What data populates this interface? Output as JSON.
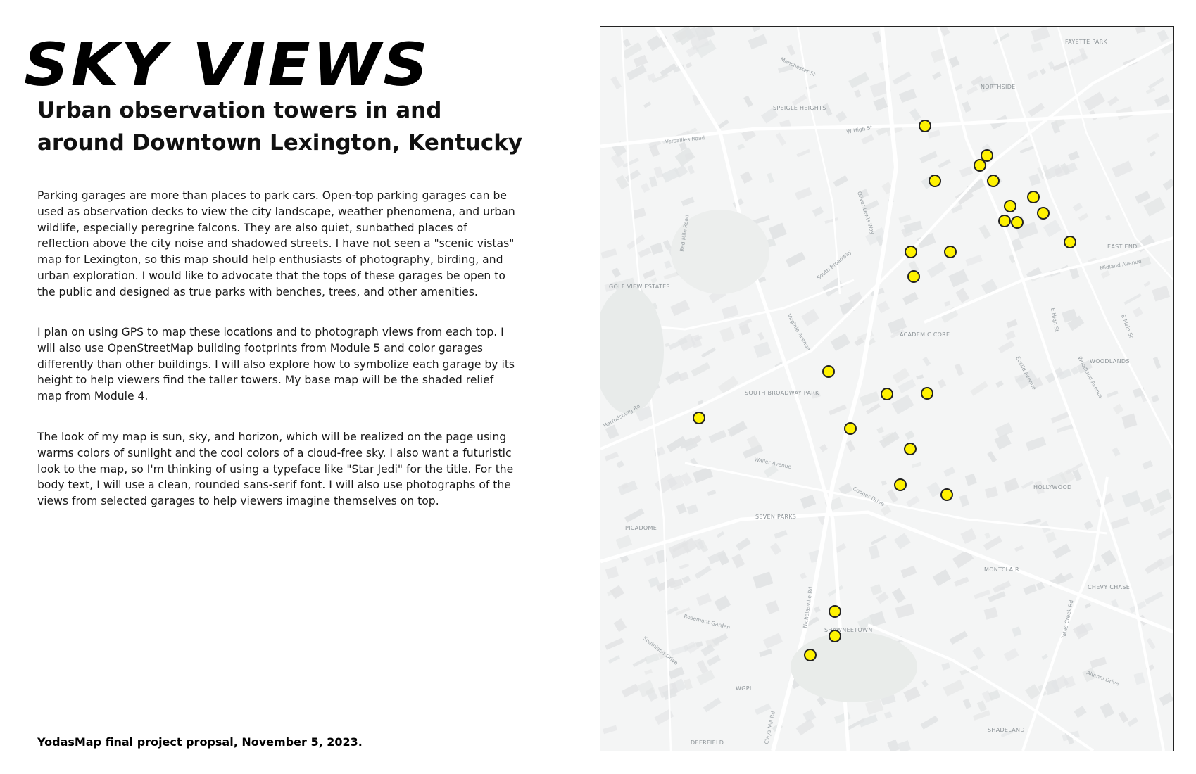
{
  "title": "SKY VIEWS",
  "subtitle": "Urban observation towers in and around Downtown Lexington, Kentucky",
  "paragraphs": [
    "Parking garages are more than places to park cars. Open-top parking garages can be used as observation decks to view the city landscape, weather phenomena, and urban wildlife, especially peregrine falcons. They are also quiet, sunbathed places of reflection above the city noise and shadowed streets. I have not seen a \"scenic vistas\" map for Lexington, so this map should help enthusiasts of photography, birding, and urban exploration. I would like to advocate that the tops of these garages be open to the public and designed as true parks with benches, trees, and other amenities.",
    "I plan on using GPS to map these locations and to photograph views from each top. I will also use OpenStreetMap building footprints from Module 5 and color garages differently than other buildings. I will also explore how to symbolize each garage by its height to help viewers find the taller towers. My base map will be the shaded relief map from Module 4.",
    "The look of my map is sun, sky, and horizon, which will be realized on the page using warms colors of sunlight and the cool colors of a cloud-free sky. I also want a futuristic look to the map, so I'm thinking of using a typeface like \"Star Jedi\" for the title. For the body text, I will use a clean, rounded sans-serif font. I will also use photographs of the views from selected garages to help viewers imagine themselves on top."
  ],
  "footer": "YodasMap final project propsal, November 5, 2023.",
  "map": {
    "colors": {
      "marker_fill": "#fff200",
      "marker_stroke": "#222222",
      "basemap": "#f4f5f5",
      "roads": "#ffffff",
      "blocks": "#e2e4e5"
    },
    "neighborhoods": [
      "FAYETTE PARK",
      "NORTHSIDE",
      "SPEIGLE HEIGHTS",
      "EAST END",
      "GOLF VIEW ESTATES",
      "ACADEMIC CORE",
      "WOODLANDS",
      "SOUTH BROADWAY PARK",
      "HOLLYWOOD",
      "SEVEN PARKS",
      "PICADOME",
      "MONTCLAIR",
      "CHEVY CHASE",
      "SHAWNEETOWN",
      "WGPL",
      "DEERFIELD",
      "SHADELAND"
    ],
    "streets": [
      "Versailles Road",
      "Manchester St",
      "W High St",
      "South Broadway",
      "Red Mile Road",
      "Oliver Lewis Way",
      "Virginia Avenue",
      "Waller Avenue",
      "Cooper Drive",
      "Harrodsburg Rd",
      "Nicholasville Rd",
      "Alumni Drive",
      "Rosemont Garden",
      "Southland Drive",
      "Euclid Avenue",
      "E High St",
      "E Main St",
      "Midland Avenue",
      "Tates Creek Rd",
      "Clays Mill Rd",
      "Woodland Avenue"
    ],
    "garage_count": 27
  }
}
